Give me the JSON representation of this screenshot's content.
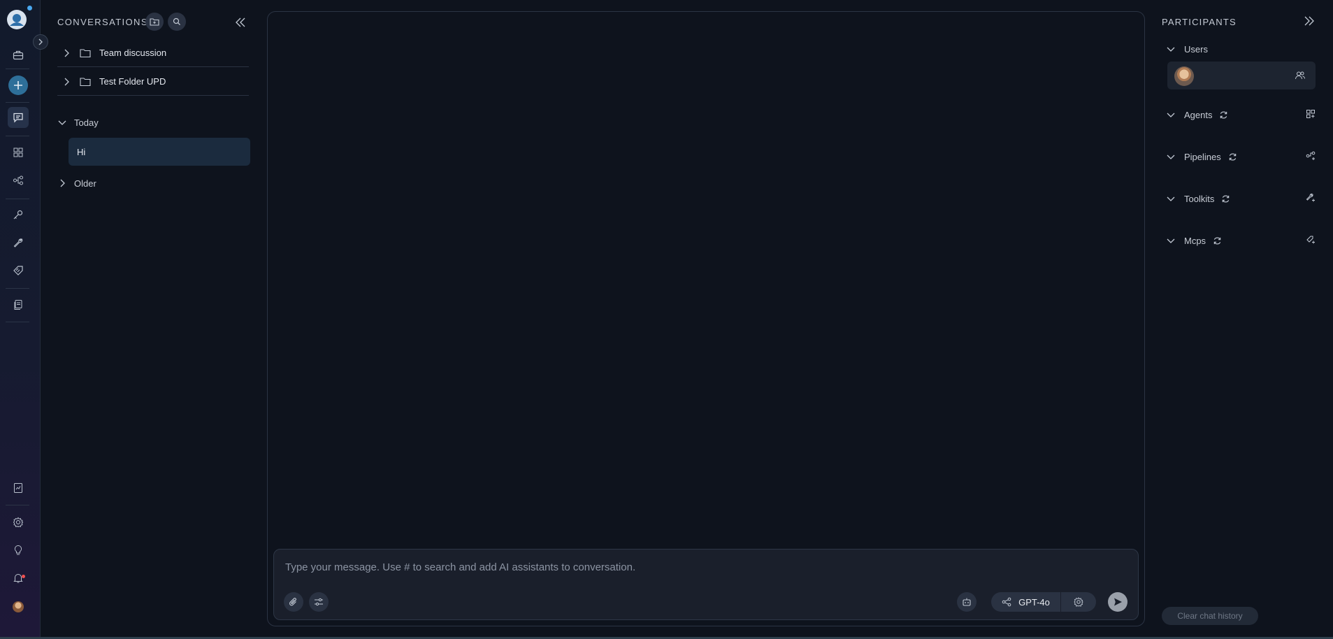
{
  "rail": {
    "icons": [
      "app-logo",
      "briefcase-icon",
      "plus-icon",
      "chat-icon",
      "grid-icon",
      "flow-icon",
      "key-icon",
      "wrench-icon",
      "tag-icon",
      "documents-icon",
      "report-icon",
      "settings-icon",
      "lightbulb-icon",
      "bell-icon",
      "user-avatar"
    ]
  },
  "conversations": {
    "title": "CONVERSATIONS",
    "folders": [
      {
        "label": "Team discussion"
      },
      {
        "label": "Test Folder UPD"
      }
    ],
    "groups": [
      {
        "label": "Today",
        "expanded": true,
        "items": [
          {
            "label": "Hi",
            "selected": true
          }
        ]
      },
      {
        "label": "Older",
        "expanded": false
      }
    ]
  },
  "composer": {
    "placeholder": "Type your message. Use # to search and add AI assistants to conversation.",
    "model": "GPT-4o"
  },
  "participants": {
    "title": "PARTICIPANTS",
    "sections": [
      {
        "label": "Users"
      },
      {
        "label": "Agents"
      },
      {
        "label": "Pipelines"
      },
      {
        "label": "Toolkits"
      },
      {
        "label": "Mcps"
      }
    ],
    "clear_label": "Clear chat history"
  },
  "colors": {
    "background": "#0e131d",
    "selected_chat": "#1b2b3e",
    "accent": "#2e6f99"
  }
}
